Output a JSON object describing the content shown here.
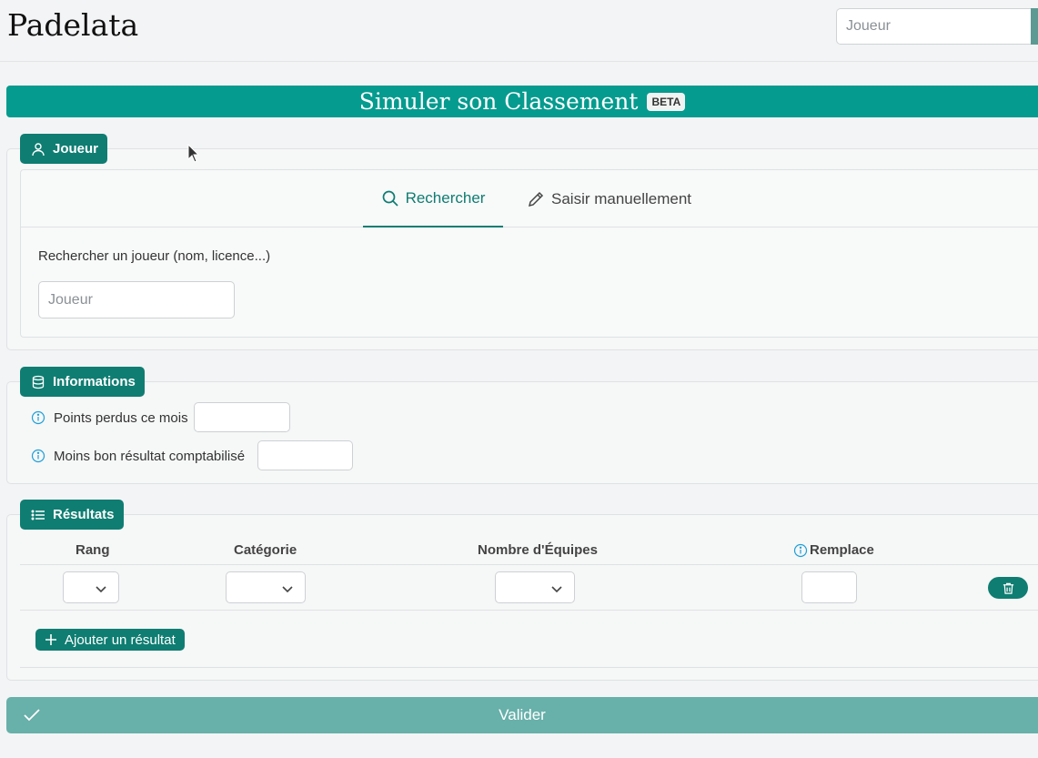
{
  "app": {
    "brand": "Padelata",
    "search_placeholder": "Joueur"
  },
  "banner": {
    "title": "Simuler son Classement",
    "badge": "BETA"
  },
  "joueur": {
    "chip_label": "Joueur",
    "tabs": [
      {
        "label": "Rechercher",
        "icon": "search-icon",
        "active": true
      },
      {
        "label": "Saisir manuellement",
        "icon": "pencil-icon",
        "active": false
      }
    ],
    "search_label": "Rechercher un joueur (nom, licence...)",
    "search_placeholder": "Joueur"
  },
  "informations": {
    "chip_label": "Informations",
    "fields": [
      {
        "label": "Points perdus ce mois",
        "value": ""
      },
      {
        "label": "Moins bon résultat comptabilisé",
        "value": ""
      }
    ]
  },
  "resultats": {
    "chip_label": "Résultats",
    "columns": [
      "Rang",
      "Catégorie",
      "Nombre d'Équipes",
      "Remplace"
    ],
    "add_label": "Ajouter un résultat"
  },
  "actions": {
    "validate_label": "Valider"
  },
  "colors": {
    "accent": "#0f7d72",
    "banner": "#069b8f",
    "validate": "#68b0aa",
    "info": "#1e9fd8"
  }
}
